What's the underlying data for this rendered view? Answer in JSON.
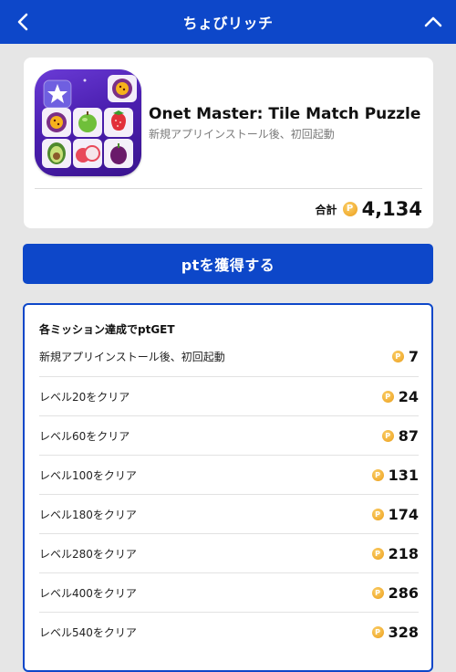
{
  "header": {
    "title": "ちょびリッチ",
    "back_icon": "chevron-left-icon",
    "collapse_icon": "chevron-up-icon",
    "bg_color": "#0d47c9"
  },
  "app": {
    "name": "Onet Master: Tile Match Puzzle",
    "subtitle": "新規アプリインストール後、初回起動",
    "total_label": "合計",
    "total_points": "4,134",
    "coin_icon": "point-coin-icon",
    "coin_glyph": "P"
  },
  "cta": {
    "label": "ptを獲得する"
  },
  "missions": {
    "heading": "各ミッション達成でptGET",
    "items": [
      {
        "label": "新規アプリインストール後、初回起動",
        "points": "7"
      },
      {
        "label": "レベル20をクリア",
        "points": "24"
      },
      {
        "label": "レベル60をクリア",
        "points": "87"
      },
      {
        "label": "レベル100をクリア",
        "points": "131"
      },
      {
        "label": "レベル180をクリア",
        "points": "174"
      },
      {
        "label": "レベル280をクリア",
        "points": "218"
      },
      {
        "label": "レベル400をクリア",
        "points": "286"
      },
      {
        "label": "レベル540をクリア",
        "points": "328"
      }
    ]
  },
  "colors": {
    "accent": "#0d47c9",
    "coin": "#f3b23a",
    "background": "#e6e6e6"
  }
}
